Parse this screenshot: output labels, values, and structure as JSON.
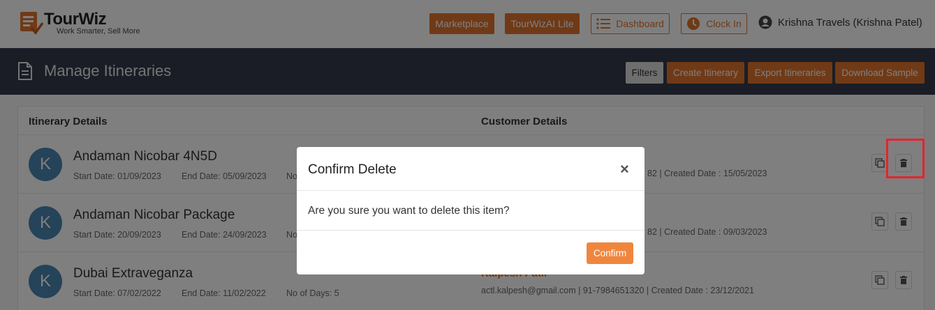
{
  "app": {
    "logo_title": "TourWiz",
    "logo_tagline": "Work Smarter, Sell More"
  },
  "topnav": {
    "marketplace": "Marketplace",
    "tourwizai": "TourWizAI Lite",
    "dashboard": "Dashboard",
    "clock_in": "Clock In",
    "user": "Krishna Travels (Krishna Patel)"
  },
  "header": {
    "title": "Manage Itineraries",
    "filters": "Filters",
    "create": "Create Itinerary",
    "export": "Export Itineraries",
    "download": "Download Sample"
  },
  "table": {
    "col_itinerary": "Itinerary Details",
    "col_customer": "Customer Details",
    "rows": [
      {
        "avatar": "K",
        "name": "Andaman Nicobar 4N5D",
        "start": "Start Date: 01/09/2023",
        "end": "End Date: 05/09/2023",
        "days": "No",
        "customer_name": "",
        "customer_meta": "82 | Created Date : 15/05/2023"
      },
      {
        "avatar": "K",
        "name": "Andaman Nicobar Package",
        "start": "Start Date: 20/09/2023",
        "end": "End Date: 24/09/2023",
        "days": "No",
        "customer_name": "",
        "customer_meta": "82 | Created Date : 09/03/2023"
      },
      {
        "avatar": "K",
        "name": "Dubai Extraveganza",
        "start": "Start Date: 07/02/2022",
        "end": "End Date: 11/02/2022",
        "days": "No of Days: 5",
        "customer_name": "Kalpesh Patil",
        "customer_meta": "actl.kalpesh@gmail.com | 91-7984651320 | Created Date : 23/12/2021"
      }
    ]
  },
  "modal": {
    "title": "Confirm Delete",
    "close": "×",
    "body": "Are you sure you want to delete this item?",
    "confirm": "Confirm"
  },
  "colors": {
    "accent": "#e0742f",
    "header_bg": "#343b4c",
    "highlight": "#e8232d"
  }
}
